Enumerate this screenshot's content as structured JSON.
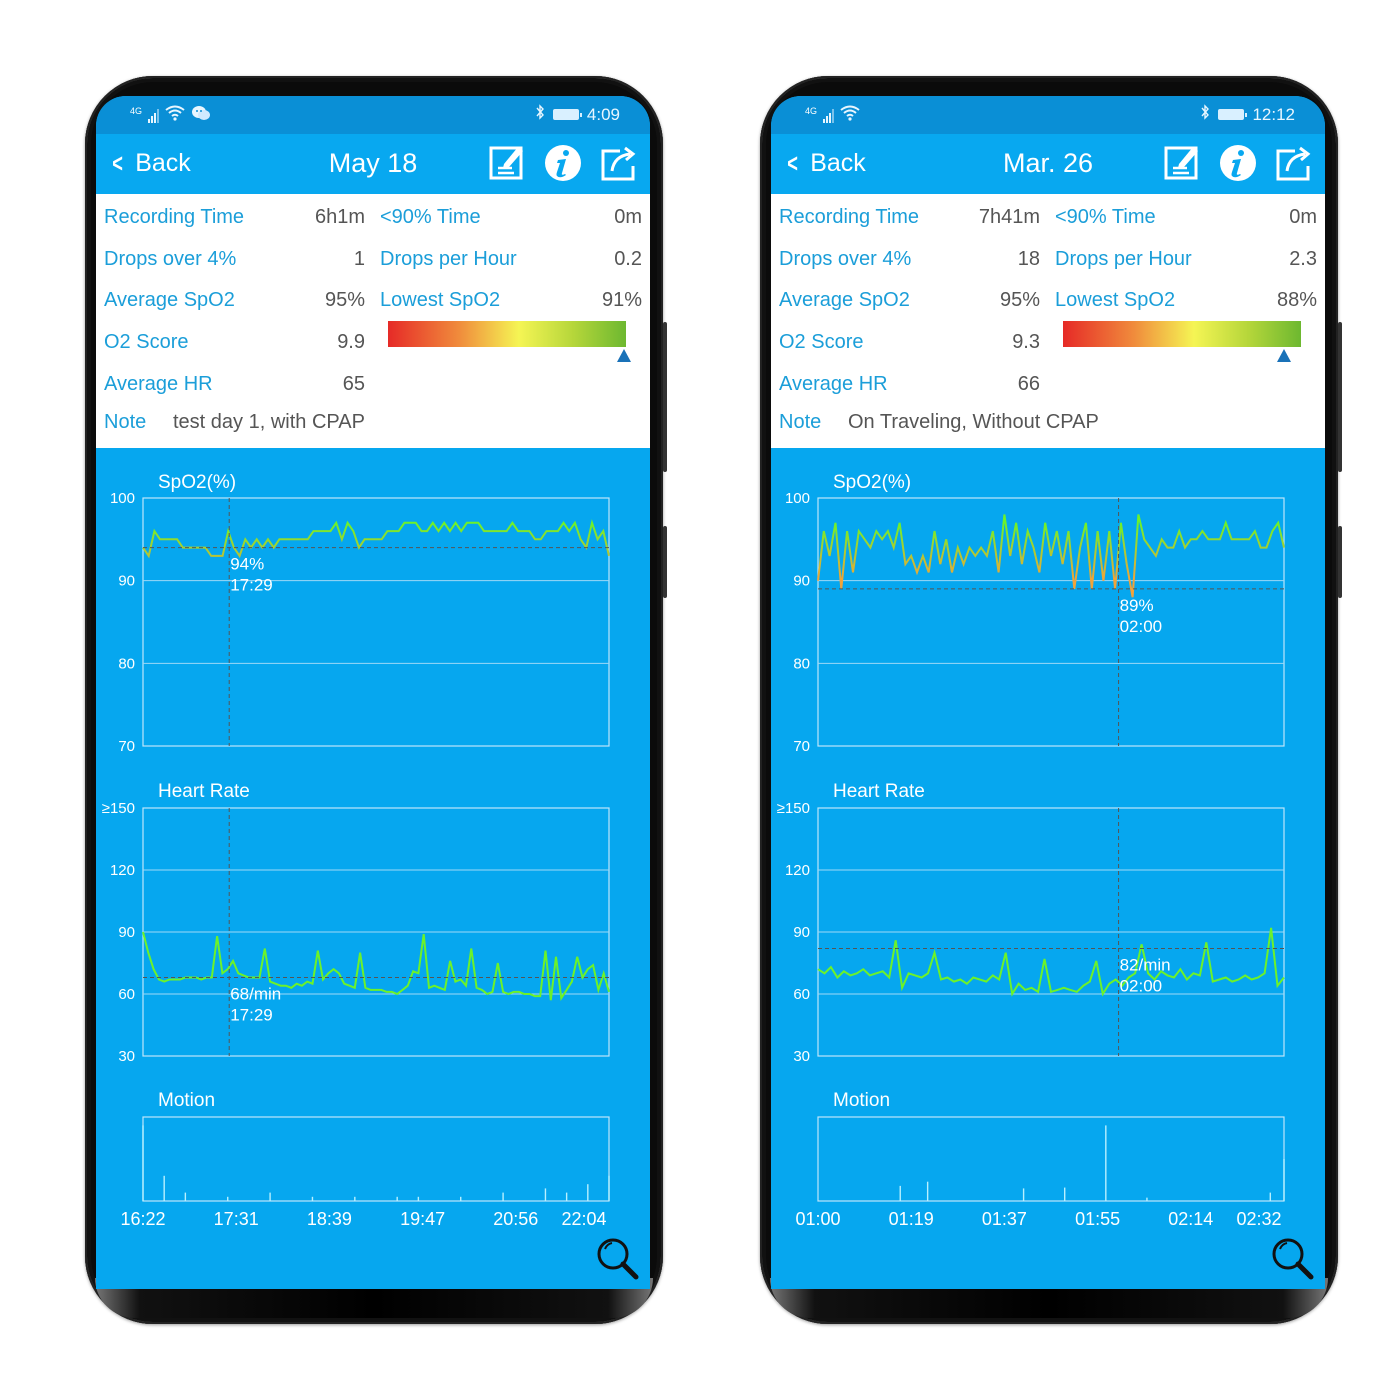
{
  "phones": [
    {
      "status": {
        "signal_label": "4G",
        "time": "4:09",
        "icons": [
          "signal-icon",
          "wifi-icon",
          "wechat-icon",
          "bluetooth-icon",
          "battery-icon"
        ]
      },
      "nav": {
        "back_label": "Back",
        "title": "May 18"
      },
      "stats": {
        "recording_time": {
          "label": "Recording Time",
          "value": "6h1m"
        },
        "below90_time": {
          "label": "<90% Time",
          "value": "0m"
        },
        "drops_over_4": {
          "label": "Drops over 4%",
          "value": "1"
        },
        "drops_per_hour": {
          "label": "Drops per Hour",
          "value": "0.2"
        },
        "average_spo2": {
          "label": "Average SpO2",
          "value": "95%"
        },
        "lowest_spo2": {
          "label": "Lowest SpO2",
          "value": "91%"
        },
        "o2_score": {
          "label": "O2 Score",
          "value": "9.9",
          "scale_fraction": 0.99
        },
        "average_hr": {
          "label": "Average HR",
          "value": "65"
        },
        "note": {
          "label": "Note",
          "value": "test day 1, with CPAP"
        }
      },
      "chart_data": [
        {
          "type": "line",
          "title": "SpO2(%)",
          "ylim": [
            70,
            100
          ],
          "yticks": [
            "100",
            "90",
            "80",
            "70"
          ],
          "cursor": {
            "x_fraction": 0.185,
            "value": 94,
            "value_label": "94%",
            "time_label": "17:29"
          },
          "series": [
            {
              "name": "SpO2",
              "values": [
                94,
                93,
                96,
                95,
                95,
                95,
                95,
                94,
                94,
                94,
                94,
                94,
                93,
                93,
                93,
                96,
                94,
                93,
                95,
                94,
                95,
                94,
                95,
                94,
                95,
                95,
                95,
                95,
                95,
                95,
                96,
                96,
                96,
                96,
                97,
                95,
                97,
                96,
                94,
                95,
                95,
                95,
                95,
                96,
                96,
                96,
                97,
                97,
                97,
                96,
                96,
                97,
                96,
                97,
                96,
                97,
                96,
                97,
                97,
                97,
                96,
                96,
                96,
                96,
                96,
                97,
                96,
                96,
                96,
                95,
                95,
                96,
                96,
                96,
                97,
                96,
                97,
                95,
                94,
                97,
                95,
                96,
                93
              ]
            }
          ]
        },
        {
          "type": "line",
          "title": "Heart Rate",
          "ylim": [
            30,
            150
          ],
          "yticks": [
            "≥150",
            "120",
            "90",
            "60",
            "30"
          ],
          "cursor": {
            "x_fraction": 0.185,
            "value": 68,
            "value_label": "68/min",
            "time_label": "17:29"
          },
          "series": [
            {
              "name": "HR",
              "values": [
                90,
                80,
                72,
                67,
                66,
                67,
                67,
                67,
                68,
                68,
                68,
                67,
                68,
                68,
                88,
                70,
                72,
                76,
                70,
                69,
                68,
                68,
                68,
                82,
                66,
                65,
                64,
                64,
                63,
                65,
                64,
                66,
                65,
                81,
                67,
                70,
                72,
                70,
                65,
                64,
                63,
                80,
                63,
                62,
                62,
                62,
                61,
                61,
                60,
                62,
                64,
                71,
                70,
                89,
                63,
                64,
                63,
                62,
                76,
                66,
                67,
                64,
                82,
                63,
                62,
                60,
                61,
                75,
                61,
                60,
                61,
                61,
                60,
                60,
                59,
                59,
                81,
                57,
                78,
                58,
                62,
                66,
                78,
                68,
                72,
                74,
                62,
                70,
                61
              ]
            }
          ]
        },
        {
          "type": "bar",
          "title": "Motion",
          "xticks": [
            "16:22",
            "17:31",
            "18:39",
            "19:47",
            "20:56",
            "22:04"
          ],
          "series": [
            {
              "name": "Motion",
              "values": [
                0.9,
                0.3,
                0.1,
                0,
                0.05,
                0,
                0.1,
                0,
                0.05,
                0,
                0.05,
                0,
                0.05,
                0.05,
                0,
                0.05,
                0,
                0.1,
                0,
                0.15,
                0.1,
                0.2,
                0.3
              ]
            }
          ]
        }
      ]
    },
    {
      "status": {
        "signal_label": "4G",
        "time": "12:12",
        "icons": [
          "signal-icon",
          "wifi-icon",
          "bluetooth-icon",
          "battery-icon"
        ]
      },
      "nav": {
        "back_label": "Back",
        "title": "Mar. 26"
      },
      "stats": {
        "recording_time": {
          "label": "Recording Time",
          "value": "7h41m"
        },
        "below90_time": {
          "label": "<90% Time",
          "value": "0m"
        },
        "drops_over_4": {
          "label": "Drops over 4%",
          "value": "18"
        },
        "drops_per_hour": {
          "label": "Drops per Hour",
          "value": "2.3"
        },
        "average_spo2": {
          "label": "Average SpO2",
          "value": "95%"
        },
        "lowest_spo2": {
          "label": "Lowest SpO2",
          "value": "88%"
        },
        "o2_score": {
          "label": "O2 Score",
          "value": "9.3",
          "scale_fraction": 0.93
        },
        "average_hr": {
          "label": "Average HR",
          "value": "66"
        },
        "note": {
          "label": "Note",
          "value": "On Traveling, Without CPAP"
        }
      },
      "chart_data": [
        {
          "type": "line",
          "title": "SpO2(%)",
          "ylim": [
            70,
            100
          ],
          "yticks": [
            "100",
            "90",
            "80",
            "70"
          ],
          "cursor": {
            "x_fraction": 0.645,
            "value": 89,
            "value_label": "89%",
            "time_label": "02:00"
          },
          "series": [
            {
              "name": "SpO2",
              "values": [
                90,
                96,
                93,
                97,
                89,
                96,
                91,
                96,
                95,
                94,
                96,
                95,
                96,
                94,
                97,
                92,
                93,
                91,
                93,
                91,
                96,
                92,
                95,
                91,
                94,
                92,
                94,
                93,
                94,
                93,
                96,
                91,
                98,
                93,
                97,
                92,
                96,
                94,
                91,
                97,
                93,
                96,
                92,
                96,
                89,
                94,
                97,
                89,
                96,
                90,
                96,
                89,
                97,
                92,
                88,
                98,
                95,
                94,
                93,
                95,
                94,
                94,
                96,
                94,
                95,
                95,
                96,
                95,
                95,
                95,
                97,
                95,
                95,
                95,
                95,
                96,
                94,
                94,
                96,
                97,
                94
              ]
            }
          ]
        },
        {
          "type": "line",
          "title": "Heart Rate",
          "ylim": [
            30,
            150
          ],
          "yticks": [
            "≥150",
            "120",
            "90",
            "60",
            "30"
          ],
          "cursor": {
            "x_fraction": 0.645,
            "value": 82,
            "value_label": "82/min",
            "time_label": "02:00"
          },
          "series": [
            {
              "name": "HR",
              "values": [
                72,
                70,
                73,
                68,
                71,
                69,
                70,
                72,
                69,
                70,
                71,
                68,
                86,
                63,
                70,
                69,
                68,
                70,
                80,
                67,
                68,
                66,
                67,
                65,
                68,
                67,
                66,
                69,
                67,
                80,
                60,
                65,
                62,
                63,
                61,
                77,
                61,
                62,
                63,
                62,
                61,
                64,
                66,
                76,
                60,
                65,
                67,
                64,
                68,
                70,
                84,
                70,
                67,
                71,
                69,
                68,
                72,
                67,
                70,
                69,
                85,
                66,
                67,
                68,
                66,
                67,
                69,
                67,
                68,
                70,
                92,
                64,
                68
              ]
            }
          ]
        },
        {
          "type": "bar",
          "title": "Motion",
          "xticks": [
            "01:00",
            "01:19",
            "01:37",
            "01:55",
            "02:14",
            "02:32"
          ],
          "series": [
            {
              "name": "Motion",
              "values": [
                0,
                0,
                0,
                0,
                0,
                0,
                0.18,
                0,
                0.23,
                0,
                0,
                0,
                0,
                0,
                0,
                0.15,
                0,
                0,
                0.16,
                0,
                0,
                0.9,
                0,
                0,
                0.04,
                0,
                0,
                0,
                0,
                0,
                0,
                0,
                0,
                0.1,
                0.5
              ]
            }
          ]
        }
      ]
    }
  ]
}
